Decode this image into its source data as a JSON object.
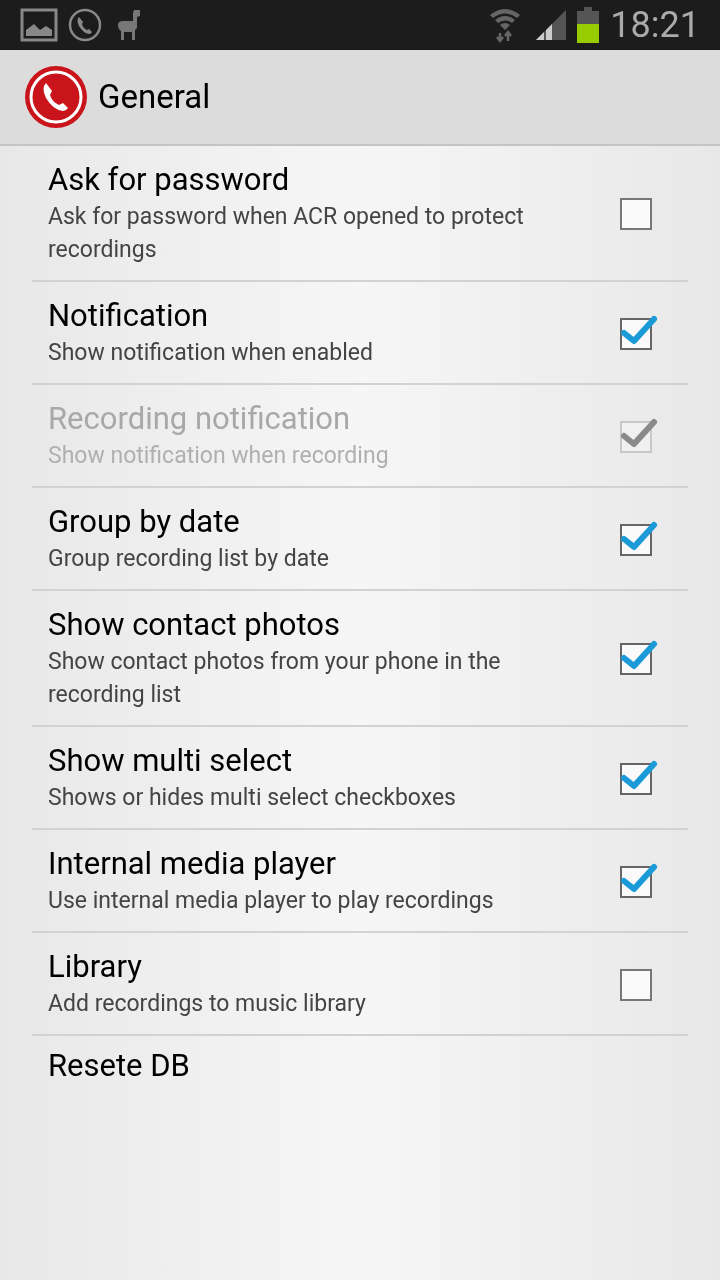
{
  "status_bar": {
    "time": "18:21"
  },
  "action_bar": {
    "title": "General"
  },
  "preferences": [
    {
      "kind": "checkbox",
      "title": "Ask for password",
      "summary": "Ask for password when ACR opened to protect recordings",
      "checked": false,
      "disabled": false
    },
    {
      "kind": "checkbox",
      "title": "Notification",
      "summary": "Show notification when enabled",
      "checked": true,
      "disabled": false
    },
    {
      "kind": "checkbox",
      "title": "Recording notification",
      "summary": "Show notification when recording",
      "checked": true,
      "disabled": true
    },
    {
      "kind": "checkbox",
      "title": "Group by date",
      "summary": "Group recording list by date",
      "checked": true,
      "disabled": false
    },
    {
      "kind": "checkbox",
      "title": "Show contact photos",
      "summary": "Show contact photos from your phone in the recording list",
      "checked": true,
      "disabled": false
    },
    {
      "kind": "checkbox",
      "title": "Show multi select",
      "summary": "Shows or hides multi select checkboxes",
      "checked": true,
      "disabled": false
    },
    {
      "kind": "checkbox",
      "title": "Internal media player",
      "summary": "Use internal media player to play recordings",
      "checked": true,
      "disabled": false
    },
    {
      "kind": "checkbox",
      "title": "Library",
      "summary": "Add recordings to music library",
      "checked": false,
      "disabled": false
    },
    {
      "kind": "plain",
      "title": "Resete DB"
    }
  ]
}
